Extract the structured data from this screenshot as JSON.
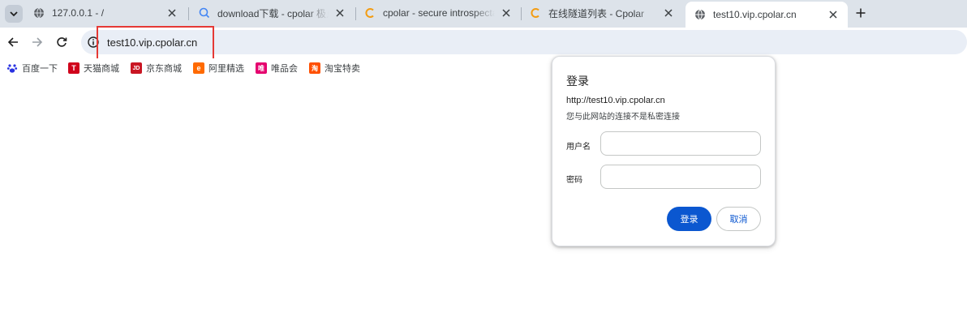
{
  "tabs": [
    {
      "title": "127.0.0.1 - /",
      "icon": "globe-icon",
      "active": false
    },
    {
      "title": "download下载 - cpolar 极点云",
      "icon": "search-icon",
      "active": false
    },
    {
      "title": "cpolar - secure introspectable",
      "icon": "cpolar-c-icon",
      "active": false
    },
    {
      "title": "在线隧道列表 - Cpolar",
      "icon": "cpolar-c-icon",
      "active": false
    },
    {
      "title": "test10.vip.cpolar.cn",
      "icon": "globe-icon",
      "active": true
    }
  ],
  "address_bar": {
    "url": "test10.vip.cpolar.cn"
  },
  "bookmarks": [
    {
      "label": "百度一下",
      "icon": "baidu-paw-icon",
      "color": "#2932e1"
    },
    {
      "label": "天猫商城",
      "icon": "tmall-icon",
      "color": "#d0021b",
      "glyph": "T"
    },
    {
      "label": "京东商城",
      "icon": "jd-icon",
      "color": "#c91623",
      "glyph": "JD"
    },
    {
      "label": "阿里精选",
      "icon": "ali-icon",
      "color": "#ff6a00",
      "glyph": "e"
    },
    {
      "label": "唯品会",
      "icon": "vip-icon",
      "color": "#e5006e",
      "glyph": "唯"
    },
    {
      "label": "淘宝特卖",
      "icon": "taobao-icon",
      "color": "#ff5000",
      "glyph": "淘"
    }
  ],
  "dialog": {
    "title": "登录",
    "origin": "http://test10.vip.cpolar.cn",
    "warning": "您与此网站的连接不是私密连接",
    "username_label": "用户名",
    "username_value": "",
    "password_label": "密码",
    "password_value": "",
    "login_label": "登录",
    "cancel_label": "取消"
  },
  "colors": {
    "accent": "#0b57d0",
    "highlight": "#e53935",
    "tabstrip": "#dde3ea"
  }
}
